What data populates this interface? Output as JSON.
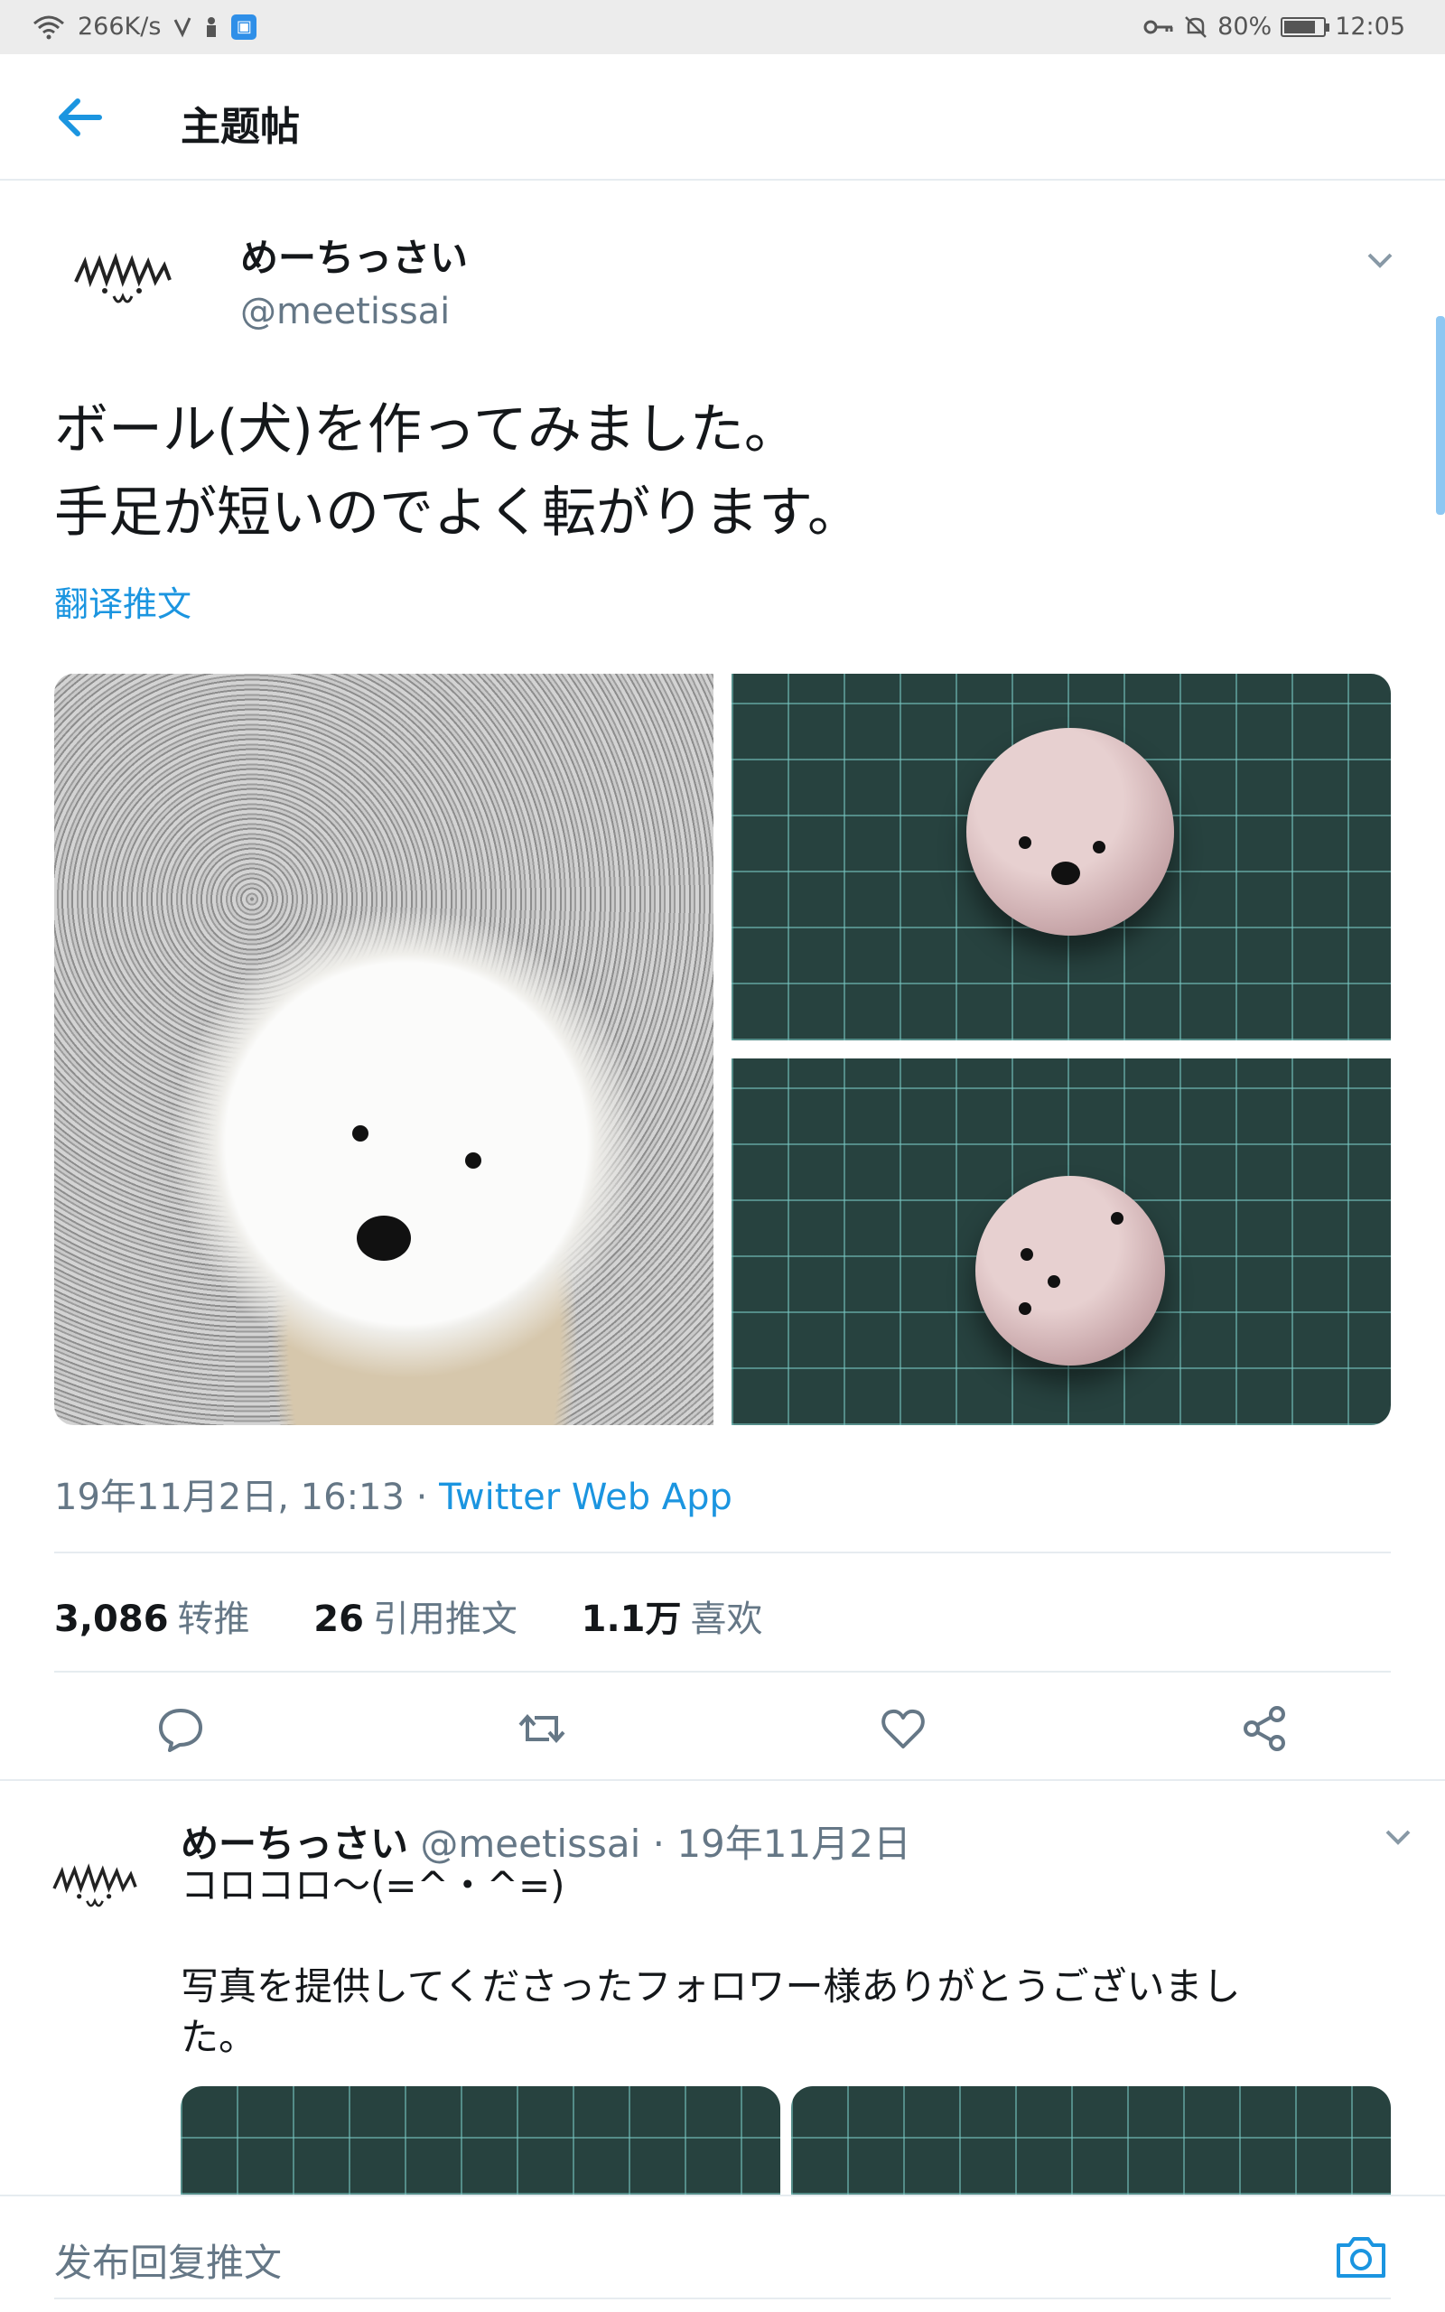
{
  "status_bar": {
    "net_speed": "266K/s",
    "battery": "80%",
    "battery_level": 0.8,
    "time": "12:05"
  },
  "header": {
    "title": "主题帖"
  },
  "tweet": {
    "display_name": "めーちっさい",
    "handle": "@meetissai",
    "text": "ボール(犬)を作ってみました。\n手足が短いのでよく転がります。",
    "translate_label": "翻译推文",
    "timestamp": "19年11月2日, 16:13 · ",
    "source": "Twitter Web App",
    "stats": {
      "retweets": "3,086",
      "retweets_label": "转推",
      "quotes": "26",
      "quotes_label": "引用推文",
      "likes": "1.1万",
      "likes_label": "喜欢"
    }
  },
  "reply": {
    "display_name": "めーちっさい",
    "meta": " @meetissai · 19年11月2日",
    "text": "コロコロ～(=^・^=)\n\n写真を提供してくださったフォロワー様ありがとうございまし\nた。"
  },
  "composer": {
    "placeholder": "发布回复推文"
  },
  "colors": {
    "accent": "#1b95e0",
    "secondary_text": "#657786",
    "divider": "#e6ecf0"
  }
}
